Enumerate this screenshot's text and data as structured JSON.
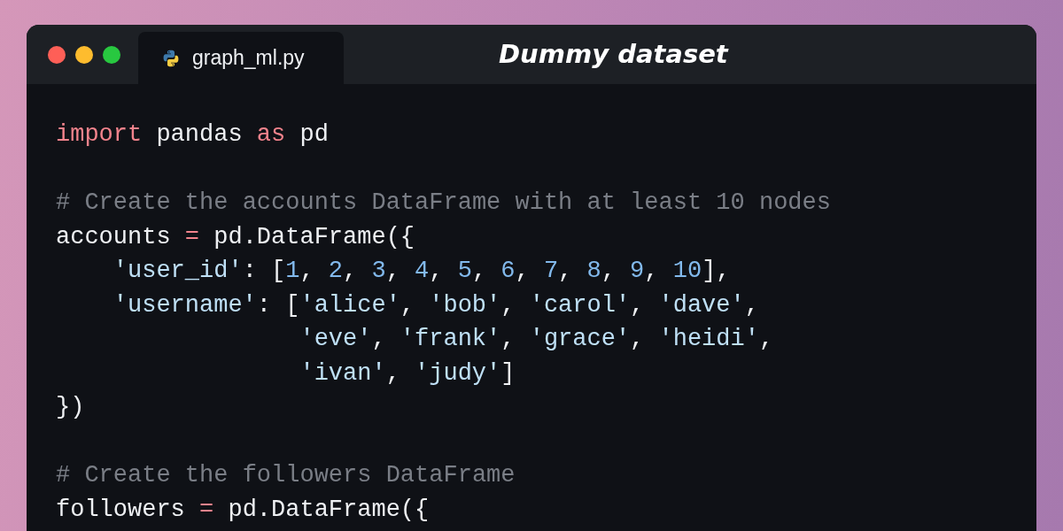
{
  "window": {
    "title": "Dummy dataset",
    "controls": [
      {
        "color": "#fe5f57"
      },
      {
        "color": "#febc2e"
      },
      {
        "color": "#28c840"
      }
    ]
  },
  "tabs": [
    {
      "label": "graph_ml.py",
      "selected": true
    }
  ],
  "code": [
    {
      "kind": "code",
      "tokens": [
        {
          "kind": "keyword",
          "text": "import"
        },
        {
          "kind": "plain",
          "text": " pandas "
        },
        {
          "kind": "keyword",
          "text": "as"
        },
        {
          "kind": "plain",
          "text": " pd"
        }
      ]
    },
    {
      "kind": "blank"
    },
    {
      "kind": "code",
      "tokens": [
        {
          "kind": "comment",
          "text": "# Create the accounts DataFrame with at least 10 nodes"
        }
      ]
    },
    {
      "kind": "code",
      "tokens": [
        {
          "kind": "plain",
          "text": "accounts "
        },
        {
          "kind": "operator",
          "text": "="
        },
        {
          "kind": "plain",
          "text": " pd.DataFrame({"
        }
      ]
    },
    {
      "kind": "entry",
      "tokens": [
        {
          "kind": "string",
          "text": "'user_id'"
        },
        {
          "kind": "plain",
          "text": ": ["
        },
        {
          "kind": "number",
          "text": "1"
        },
        {
          "kind": "plain",
          "text": ", "
        },
        {
          "kind": "number",
          "text": "2"
        },
        {
          "kind": "plain",
          "text": ", "
        },
        {
          "kind": "number",
          "text": "3"
        },
        {
          "kind": "plain",
          "text": ", "
        },
        {
          "kind": "number",
          "text": "4"
        },
        {
          "kind": "plain",
          "text": ", "
        },
        {
          "kind": "number",
          "text": "5"
        },
        {
          "kind": "plain",
          "text": ", "
        },
        {
          "kind": "number",
          "text": "6"
        },
        {
          "kind": "plain",
          "text": ", "
        },
        {
          "kind": "number",
          "text": "7"
        },
        {
          "kind": "plain",
          "text": ", "
        },
        {
          "kind": "number",
          "text": "8"
        },
        {
          "kind": "plain",
          "text": ", "
        },
        {
          "kind": "number",
          "text": "9"
        },
        {
          "kind": "plain",
          "text": ", "
        },
        {
          "kind": "number",
          "text": "10"
        },
        {
          "kind": "plain",
          "text": "],"
        }
      ]
    },
    {
      "kind": "entry",
      "tokens": [
        {
          "kind": "string",
          "text": "'username'"
        },
        {
          "kind": "plain",
          "text": ": ["
        },
        {
          "kind": "string",
          "text": "'alice'"
        },
        {
          "kind": "plain",
          "text": ", "
        },
        {
          "kind": "string",
          "text": "'bob'"
        },
        {
          "kind": "plain",
          "text": ", "
        },
        {
          "kind": "string",
          "text": "'carol'"
        },
        {
          "kind": "plain",
          "text": ", "
        },
        {
          "kind": "string",
          "text": "'dave'"
        },
        {
          "kind": "plain",
          "text": ","
        }
      ]
    },
    {
      "kind": "continuation",
      "tokens": [
        {
          "kind": "string",
          "text": "'eve'"
        },
        {
          "kind": "plain",
          "text": ", "
        },
        {
          "kind": "string",
          "text": "'frank'"
        },
        {
          "kind": "plain",
          "text": ", "
        },
        {
          "kind": "string",
          "text": "'grace'"
        },
        {
          "kind": "plain",
          "text": ", "
        },
        {
          "kind": "string",
          "text": "'heidi'"
        },
        {
          "kind": "plain",
          "text": ","
        }
      ]
    },
    {
      "kind": "continuation",
      "tokens": [
        {
          "kind": "string",
          "text": "'ivan'"
        },
        {
          "kind": "plain",
          "text": ", "
        },
        {
          "kind": "string",
          "text": "'judy'"
        },
        {
          "kind": "plain",
          "text": "]"
        }
      ]
    },
    {
      "kind": "code",
      "tokens": [
        {
          "kind": "plain",
          "text": "})"
        }
      ]
    },
    {
      "kind": "blank"
    },
    {
      "kind": "code",
      "tokens": [
        {
          "kind": "comment",
          "text": "# Create the followers DataFrame"
        }
      ]
    },
    {
      "kind": "code",
      "tokens": [
        {
          "kind": "plain",
          "text": "followers "
        },
        {
          "kind": "operator",
          "text": "="
        },
        {
          "kind": "plain",
          "text": " pd.DataFrame({"
        }
      ]
    }
  ]
}
